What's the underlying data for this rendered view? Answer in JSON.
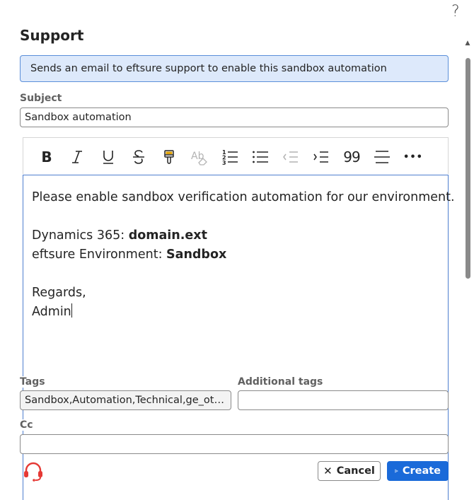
{
  "help": {
    "symbol": "?"
  },
  "dialog": {
    "title": "Support",
    "info_message": "Sends an email to eftsure support to enable this sandbox automation"
  },
  "subject": {
    "label": "Subject",
    "value": "Sandbox automation"
  },
  "editor": {
    "toolbar": [
      "bold-icon",
      "italic-icon",
      "underline-icon",
      "strikethrough-icon",
      "format-painter-icon",
      "clear-formatting-icon",
      "numbered-list-icon",
      "bullet-list-icon",
      "decrease-indent-icon",
      "increase-indent-icon",
      "quote-icon",
      "align-icon",
      "more-icon"
    ],
    "quote_glyph": "99",
    "more_glyph": "•••",
    "line1": "Please enable sandbox verification automation for our environment.",
    "line2_prefix": "Dynamics 365: ",
    "line2_value": "domain.ext",
    "line3_prefix": "eftsure Environment: ",
    "line3_value": "Sandbox",
    "line4": "Regards,",
    "line5": "Admin"
  },
  "tags": {
    "label": "Tags",
    "value": "Sandbox,Automation,Technical,ge_other"
  },
  "additional_tags": {
    "label": "Additional tags",
    "value": ""
  },
  "cc": {
    "label": "Cc",
    "value": ""
  },
  "buttons": {
    "cancel": "Cancel",
    "create": "Create"
  },
  "colors": {
    "primary": "#1a6ad9",
    "info_bg": "#dde9fb",
    "info_border": "#5b8fd9",
    "support_icon": "#e53935"
  }
}
